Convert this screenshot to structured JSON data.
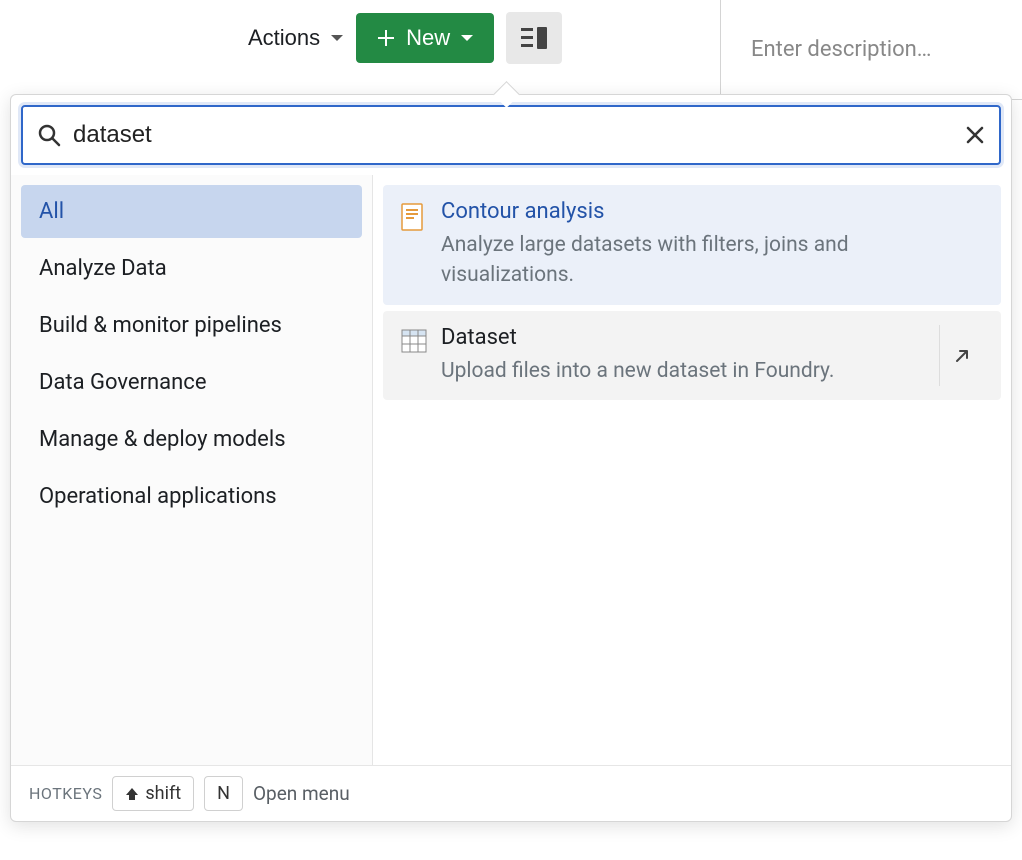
{
  "toolbar": {
    "actions_label": "Actions",
    "new_label": "New"
  },
  "description_placeholder": "Enter description…",
  "search": {
    "value": "dataset"
  },
  "categories": [
    {
      "label": "All",
      "selected": true
    },
    {
      "label": "Analyze Data",
      "selected": false
    },
    {
      "label": "Build & monitor pipelines",
      "selected": false
    },
    {
      "label": "Data Governance",
      "selected": false
    },
    {
      "label": "Manage & deploy models",
      "selected": false
    },
    {
      "label": "Operational applications",
      "selected": false
    }
  ],
  "results": [
    {
      "title": "Contour analysis",
      "description": "Analyze large datasets with filters, joins and visualizations.",
      "highlighted": true,
      "icon": "document"
    },
    {
      "title": "Dataset",
      "description": "Upload files into a new dataset in Foundry.",
      "hovered": true,
      "icon": "table",
      "has_open_action": true
    }
  ],
  "footer": {
    "label": "HOTKEYS",
    "key1": "shift",
    "key2": "N",
    "hint": "Open menu"
  }
}
